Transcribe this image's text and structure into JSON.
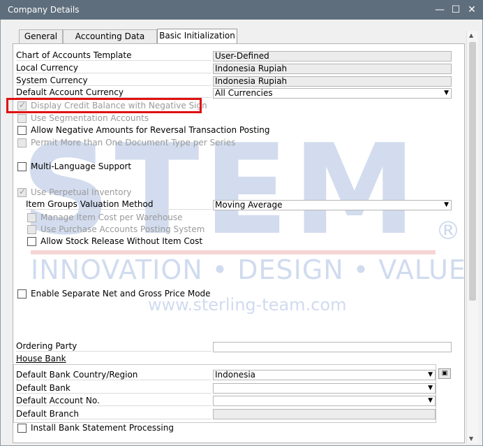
{
  "window": {
    "title": "Company Details"
  },
  "tabs": [
    {
      "label": "General",
      "active": false
    },
    {
      "label": "Accounting Data",
      "active": false
    },
    {
      "label": "Basic Initialization",
      "active": true
    }
  ],
  "fields": {
    "chart_of_accounts_template": {
      "label": "Chart of Accounts Template",
      "value": "User-Defined"
    },
    "local_currency": {
      "label": "Local Currency",
      "value": "Indonesia Rupiah"
    },
    "system_currency": {
      "label": "System Currency",
      "value": "Indonesia Rupiah"
    },
    "default_account_currency": {
      "label": "Default Account Currency",
      "value": "All Currencies"
    }
  },
  "checkboxes": {
    "display_credit_balance": {
      "label": "Display Credit Balance with Negative Sign",
      "checked": true,
      "enabled": false
    },
    "use_segmentation": {
      "label": "Use Segmentation Accounts",
      "checked": false,
      "enabled": false
    },
    "allow_negative_amounts": {
      "label": "Allow Negative Amounts for Reversal Transaction Posting",
      "checked": false,
      "enabled": true
    },
    "permit_more_doc_types": {
      "label": "Permit More than One Document Type per Series",
      "checked": false,
      "enabled": false
    },
    "multi_language": {
      "label": "Multi-Language Support",
      "checked": false,
      "enabled": true
    },
    "use_perpetual_inventory": {
      "label": "Use Perpetual Inventory",
      "checked": true,
      "enabled": false
    },
    "manage_item_cost": {
      "label": "Manage Item Cost per Warehouse",
      "checked": false,
      "enabled": false
    },
    "use_purchase_accounts": {
      "label": "Use Purchase Accounts Posting System",
      "checked": false,
      "enabled": false
    },
    "allow_stock_release": {
      "label": "Allow Stock Release Without Item Cost",
      "checked": false,
      "enabled": true
    },
    "separate_net_gross": {
      "label": "Enable Separate Net and Gross Price Mode",
      "checked": false,
      "enabled": true
    },
    "install_bank_statement": {
      "label": "Install Bank Statement Processing",
      "checked": false,
      "enabled": true
    }
  },
  "inventory": {
    "item_groups_valuation": {
      "label": "Item Groups Valuation Method",
      "value": "Moving Average"
    }
  },
  "ordering_party": {
    "label": "Ordering Party",
    "value": ""
  },
  "house_bank": {
    "heading": "House Bank",
    "country": {
      "label": "Default Bank Country/Region",
      "value": "Indonesia"
    },
    "bank": {
      "label": "Default Bank",
      "value": ""
    },
    "account_no": {
      "label": "Default Account No.",
      "value": ""
    },
    "branch": {
      "label": "Default Branch",
      "value": ""
    }
  },
  "watermark": {
    "logo_text": "STEM",
    "registered": "®",
    "tagline": "INNOVATION • DESIGN • VALUE",
    "url": "www.sterling-team.com"
  },
  "icons": {
    "minimize": "minimize-icon",
    "maximize": "maximize-icon",
    "close": "close-icon",
    "dropdown": "chevron-down-icon"
  }
}
